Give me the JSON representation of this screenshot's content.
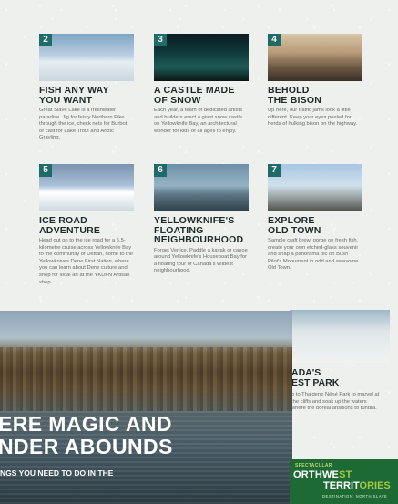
{
  "colors": {
    "accent_teal": "#1f6b6a",
    "logo_green": "#1d6a35",
    "logo_lime": "#a2c842"
  },
  "cards": [
    {
      "number": "2",
      "title_line1": "FISH ANY WAY",
      "title_line2": "YOU WANT",
      "body": "Great Slave Lake is a freshwater paradise. Jig for feisty Northern Pike through the ice, check nets for Burbot, or cast for Lake Trout and Arctic Grayling."
    },
    {
      "number": "3",
      "title_line1": "A CASTLE MADE",
      "title_line2": "OF SNOW",
      "body": "Each year, a team of dedicated artists and builders erect a giant snow castle on Yellowknife Bay, an architectural wonder for kids of all ages to enjoy."
    },
    {
      "number": "4",
      "title_line1": "BEHOLD",
      "title_line2": "THE BISON",
      "body": "Up here, our traffic jams look a little different. Keep your eyes peeled for herds of hulking bison on the highway."
    },
    {
      "number": "5",
      "title_line1": "ICE ROAD",
      "title_line2": "ADVENTURE",
      "body": "Head out on to the ice road for a 6.5-kilometre cruise across Yellowknife Bay to the community of Dettah, home to the Yellowknives Dene First Nation, where you can learn about Dene culture and shop for local art at the YKDFN Artisan shop."
    },
    {
      "number": "6",
      "title_line1": "YELLOWKNIFE'S",
      "title_line2": "FLOATING",
      "title_line3": "NEIGHBOURHOOD",
      "body": "Forget Venice. Paddle a kayak or canoe around Yellowknife's Houseboat Bay for a floating tour of Canada's wildest neighbourhood."
    },
    {
      "number": "7",
      "title_line1": "EXPLORE",
      "title_line2": "OLD TOWN",
      "body": "Sample craft brew, gorge on fresh fish, create your own etched-glass souvenir and snap a panorama pic on Bush Pilot's Monument in odd and awesome Old Town."
    }
  ],
  "partial_card": {
    "title_line1": "ADA'S",
    "title_line2": "EST PARK",
    "body": "p to Thaidene Nëné Park to marvel at the cliffs and soak up the waters where the boreal ansitions to tundra."
  },
  "hero": {
    "headline_line1": "ERE MAGIC AND",
    "headline_line2": "NDER ABOUNDS",
    "subhead": "NGS YOU NEED TO DO IN THE"
  },
  "logo": {
    "small": "SPECTACULAR",
    "main_part1": "ORTHWE",
    "main_accent1": "ST",
    "main_part2": "TERRIT",
    "main_accent2": "ORIES",
    "tagline": "DESTINATION: NORTH SLAVE"
  }
}
